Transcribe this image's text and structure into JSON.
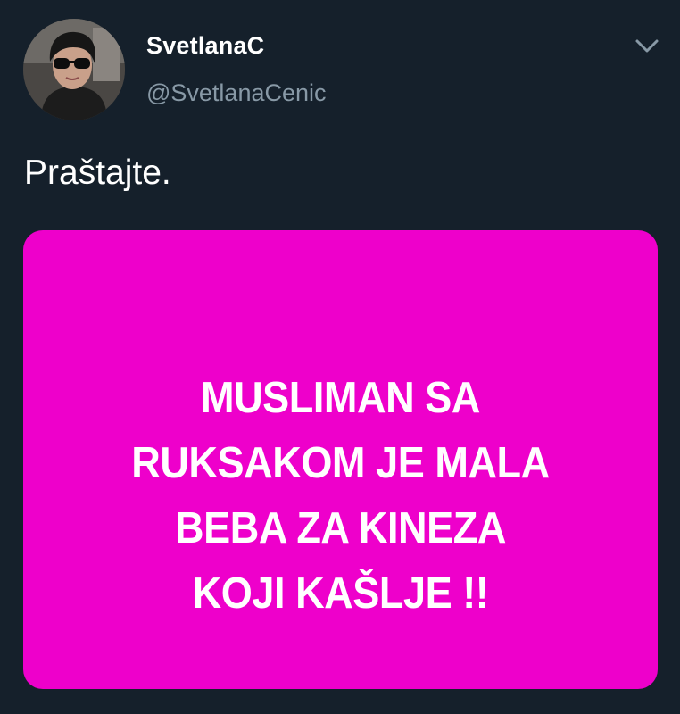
{
  "tweet": {
    "author": {
      "display_name": "SvetlanaC",
      "handle": "@SvetlanaCenic",
      "avatar_icon": "profile-photo"
    },
    "menu_icon": "chevron-down-icon",
    "text": "Praštajte.",
    "media": {
      "background_color": "#ee00cb",
      "text_color": "#ffffff",
      "lines": [
        "MUSLIMAN SA",
        "RUKSAKOM JE MALA",
        "BEBA ZA KINEZA",
        "KOJI KAŠLJE !!"
      ]
    }
  },
  "colors": {
    "background": "#15202b",
    "secondary_text": "#8899a6",
    "primary_text": "#ffffff"
  }
}
